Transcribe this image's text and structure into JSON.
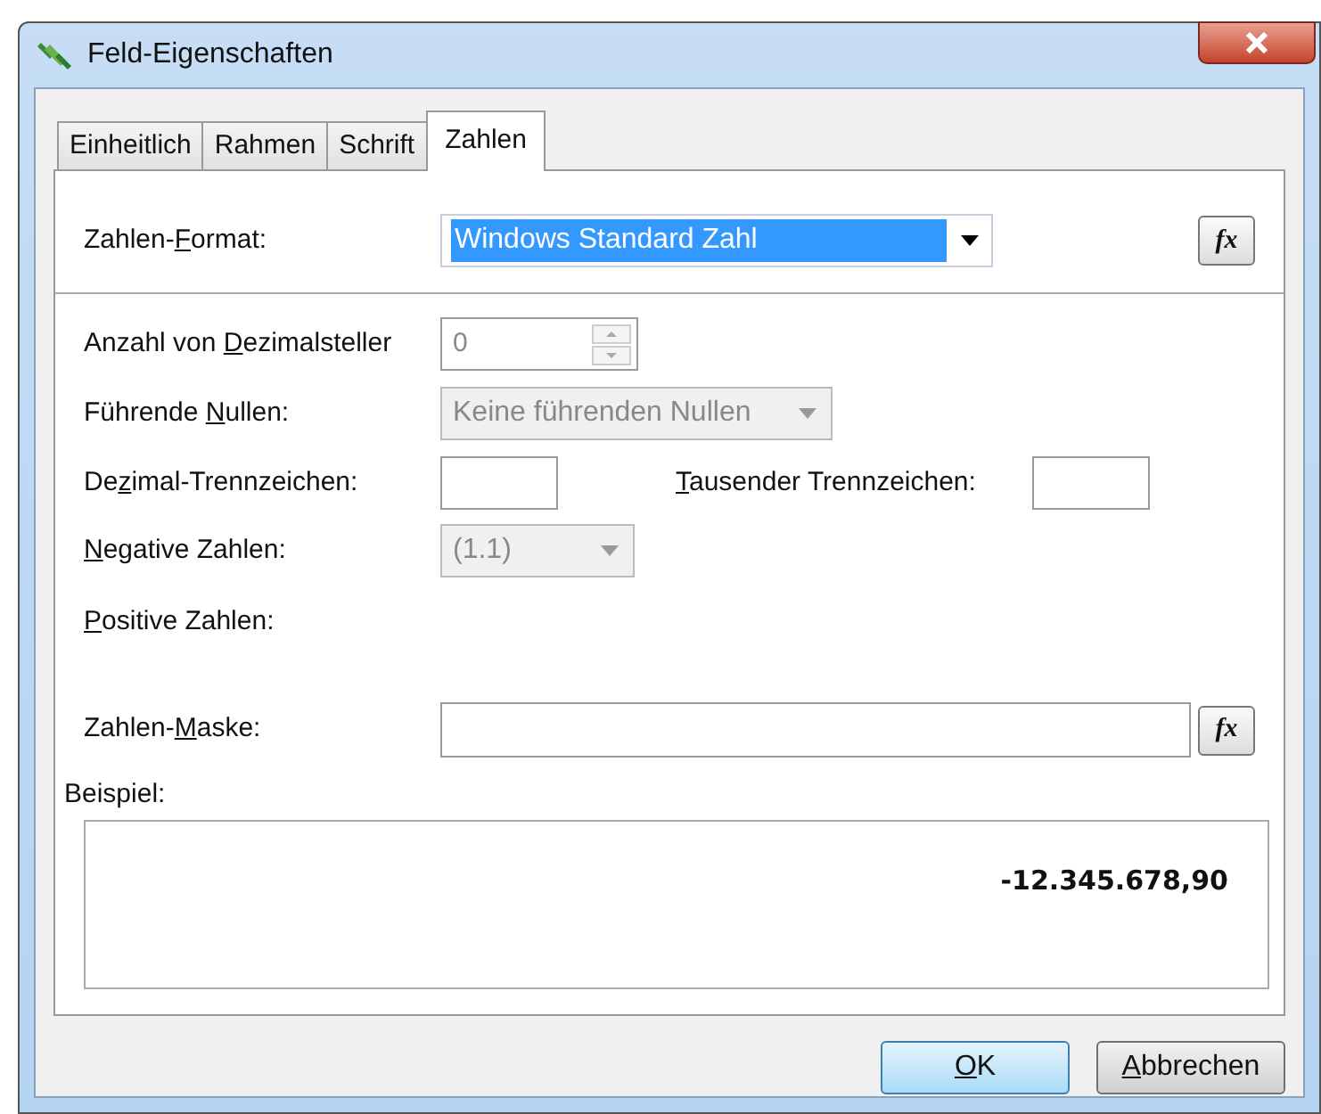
{
  "window": {
    "title": "Feld-Eigenschaften"
  },
  "tabs": [
    {
      "label": "Einheitlich",
      "selected": false
    },
    {
      "label": "Rahmen",
      "selected": false
    },
    {
      "label": "Schrift",
      "selected": false
    },
    {
      "label": "Zahlen",
      "selected": true
    }
  ],
  "number_format": {
    "label": [
      {
        "text": "Zahlen-",
        "underlined": false
      },
      {
        "text": "F",
        "underlined": true
      },
      {
        "text": "ormat:",
        "underlined": false
      }
    ],
    "value": "Windows Standard Zahl",
    "highlighted": true,
    "formula_button": "fx"
  },
  "decimal_places": {
    "label": [
      {
        "text": "Anzahl von ",
        "underlined": false
      },
      {
        "text": "D",
        "underlined": true
      },
      {
        "text": "ezimalsteller",
        "underlined": false
      }
    ],
    "value": "0",
    "disabled": true
  },
  "leading_zeros": {
    "label": [
      {
        "text": "Führende ",
        "underlined": false
      },
      {
        "text": "N",
        "underlined": true
      },
      {
        "text": "ullen:",
        "underlined": false
      }
    ],
    "value": "Keine führenden Nullen",
    "disabled": true
  },
  "decimal_separator": {
    "label": [
      {
        "text": "De",
        "underlined": false
      },
      {
        "text": "z",
        "underlined": true
      },
      {
        "text": "imal-Trennzeichen:",
        "underlined": false
      }
    ]
  },
  "thousands_separator": {
    "label": [
      {
        "text": "T",
        "underlined": true
      },
      {
        "text": "ausender Trennzeichen:",
        "underlined": false
      }
    ]
  },
  "negative_numbers": {
    "label": [
      {
        "text": "N",
        "underlined": true
      },
      {
        "text": "egative Zahlen:",
        "underlined": false
      }
    ],
    "value": "(1.1)",
    "disabled": true
  },
  "positive_numbers": {
    "label": [
      {
        "text": "P",
        "underlined": true
      },
      {
        "text": "ositive Zahlen:",
        "underlined": false
      }
    ]
  },
  "number_mask": {
    "label": [
      {
        "text": "Zahlen-",
        "underlined": false
      },
      {
        "text": "M",
        "underlined": true
      },
      {
        "text": "aske:",
        "underlined": false
      }
    ],
    "formula_button": "fx"
  },
  "example": {
    "label": "Beispiel:",
    "value": "-12.345.678,90"
  },
  "buttons": [
    {
      "label": [
        {
          "text": "O",
          "underlined": true
        },
        {
          "text": "K",
          "underlined": false
        }
      ],
      "default": true
    },
    {
      "label": [
        {
          "text": "A",
          "underlined": true
        },
        {
          "text": "bbrechen",
          "underlined": false
        }
      ],
      "default": false
    }
  ]
}
